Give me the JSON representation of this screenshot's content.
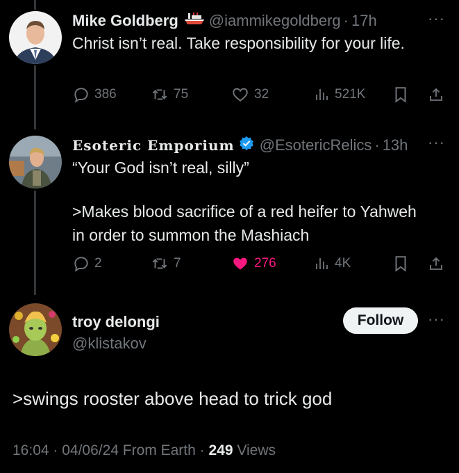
{
  "tweets": [
    {
      "display_name": "Mike Goldberg",
      "handle": "@iammikegoldberg",
      "time": "17h",
      "text": "Christ isn’t real. Take responsibility for your life.",
      "replies": "386",
      "reposts": "75",
      "likes": "32",
      "views": "521K"
    },
    {
      "display_name": "Esoteric Emporium",
      "handle": "@EsotericRelics",
      "time": "13h",
      "text_line1": "“Your God isn’t real, silly”",
      "text_line2": ">Makes blood sacrifice of a red heifer to Yahweh in order to summon the Mashiach",
      "replies": "2",
      "reposts": "7",
      "likes": "276",
      "views": "4K"
    }
  ],
  "main_tweet": {
    "display_name": "troy delongi",
    "handle": "@klistakov",
    "follow_label": "Follow",
    "text": ">swings rooster above head to trick god",
    "timestamp": "16:04 · 04/06/24 From Earth · ",
    "views_count": "249",
    "views_label": " Views"
  },
  "more_glyph": "···",
  "dot": "·",
  "colors": {
    "background": "#000000",
    "text": "#e7e9ea",
    "muted": "#71767b",
    "like": "#f91880",
    "verified": "#1d9bf0"
  }
}
